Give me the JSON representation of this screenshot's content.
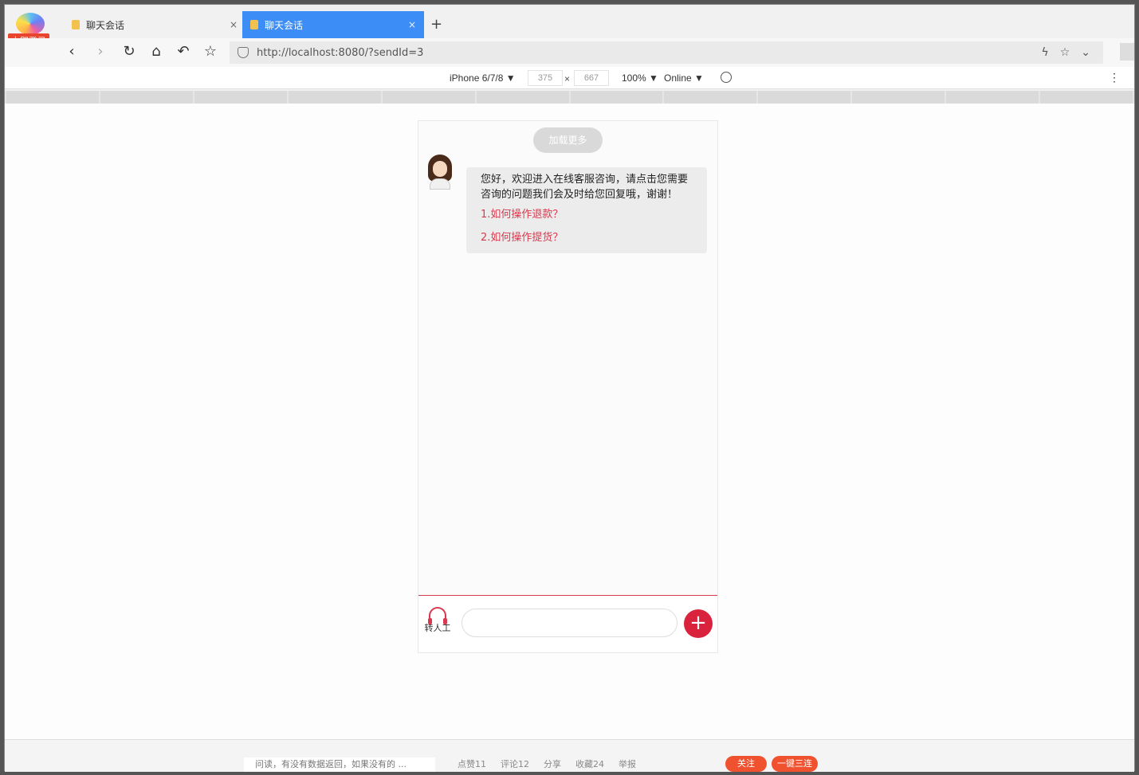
{
  "browser": {
    "login_badge": "立即登录",
    "tabs": [
      {
        "title": "聊天会话",
        "close": "×"
      },
      {
        "title": "聊天会话",
        "close": "×"
      }
    ],
    "new_tab": "+",
    "url": "http://localhost:8080/?sendId=3",
    "nav": {
      "back": "‹",
      "forward": "›",
      "reload": "↻",
      "home": "⌂",
      "undo": "↶",
      "star": "☆"
    },
    "url_icons": {
      "lightning": "ϟ",
      "star": "☆",
      "dropdown": "⌄"
    }
  },
  "devtools": {
    "device": "iPhone 6/7/8 ▼",
    "width": "375",
    "height": "667",
    "times": "×",
    "zoom": "100% ▼",
    "network": "Online ▼",
    "menu": "⋮"
  },
  "chat": {
    "load_more": "加载更多",
    "greeting": "您好，欢迎进入在线客服咨询，请点击您需要咨询的问题我们会及时给您回复哦，谢谢！",
    "questions": [
      "1.如何操作退款？",
      "2.如何操作提货？"
    ],
    "human_label": "转人工",
    "input_placeholder": "",
    "plus": "+"
  },
  "background_page": {
    "snippet": "问读，有没有数据返回，如果没有的 ...",
    "actions": [
      "点赞11",
      "评论12",
      "分享",
      "收藏24",
      "举报"
    ],
    "follow": "关注",
    "one_click": "一键三连"
  },
  "colors": {
    "accent": "#d9394e",
    "tab_active": "#3c8df5",
    "badge": "#e8442e"
  }
}
